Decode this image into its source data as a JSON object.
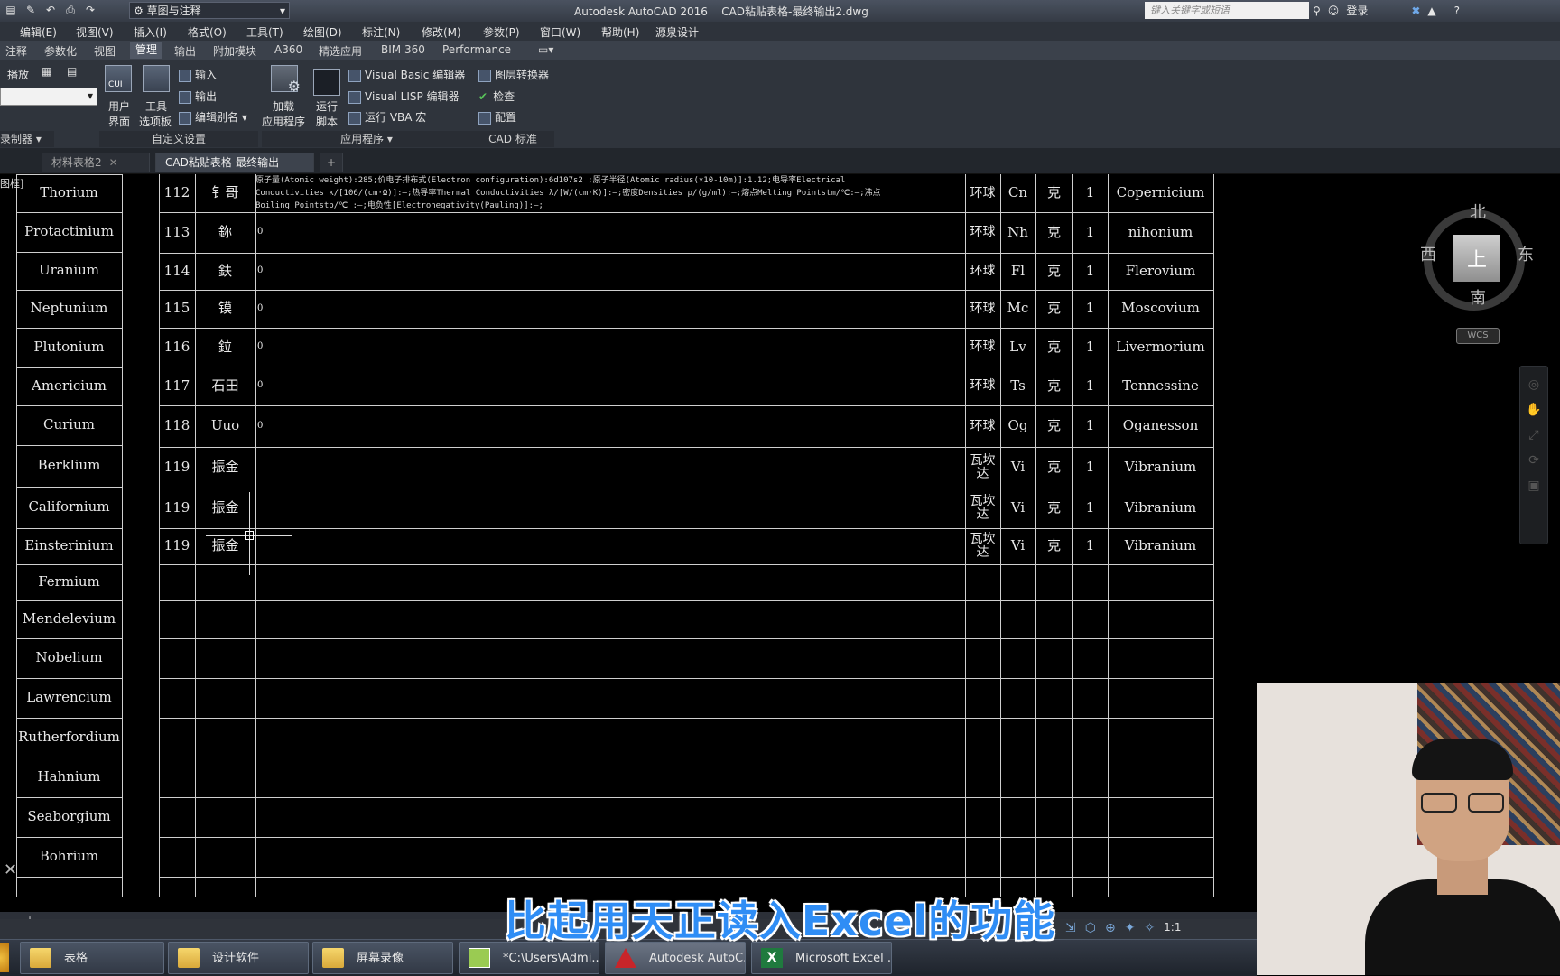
{
  "titlebar": {
    "workspace": "草图与注释",
    "app_name": "Autodesk AutoCAD 2016",
    "file_name": "CAD粘贴表格-最终输出2.dwg",
    "search_placeholder": "键入关键字或短语",
    "login": "登录"
  },
  "menubar": [
    "编辑(E)",
    "视图(V)",
    "插入(I)",
    "格式(O)",
    "工具(T)",
    "绘图(D)",
    "标注(N)",
    "修改(M)",
    "参数(P)",
    "窗口(W)",
    "帮助(H)",
    "源泉设计"
  ],
  "ribbon_tabs": [
    "注释",
    "参数化",
    "视图",
    "管理",
    "输出",
    "附加模块",
    "A360",
    "精选应用",
    "BIM 360",
    "Performance"
  ],
  "active_tab": "管理",
  "ribbon": {
    "play": "播放",
    "recorder_panel": "录制器",
    "cui_top": "用户",
    "cui_bottom": "界面",
    "tool_top": "工具",
    "tool_bottom": "选项板",
    "import": "输入",
    "export": "输出",
    "edit_aliases": "编辑别名",
    "customize_panel": "自定义设置",
    "load_top": "加载",
    "load_bottom": "应用程序",
    "run_top": "运行",
    "run_bottom": "脚本",
    "vba_editor": "Visual Basic 编辑器",
    "lisp_editor": "Visual LISP 编辑器",
    "run_vba": "运行 VBA 宏",
    "apps_panel": "应用程序",
    "layer_translator": "图层转换器",
    "check": "检查",
    "configure": "配置",
    "cad_std_panel": "CAD 标准"
  },
  "file_tabs": [
    {
      "label": "材料表格2",
      "active": false
    },
    {
      "label": "CAD粘贴表格-最终输出2*",
      "active": true
    }
  ],
  "left_names": {
    "header_fragment": "图框]",
    "items": [
      "Thorium",
      "Protactinium",
      "Uranium",
      "Neptunium",
      "Plutonium",
      "Americium",
      "Curium",
      "Berklium",
      "Californium",
      "Einsterinium",
      "Fermium",
      "Mendelevium",
      "Nobelium",
      "Lawrencium",
      "Rutherfordium",
      "Hahnium",
      "Seaborgium",
      "Bohrium"
    ]
  },
  "long_text": [
    "原子量(Atomic weight):285;价电子排布式(Electron configuration):6d107s2 ;原子半径(Atomic radius(×10-10m)]:1.12;电导率Electrical",
    "Conductivities κ/[106/(cm·Ω)]:—;热导率Thermal Conductivities λ/[W/(cm·K)]:—;密度Densities ρ/(g/ml):—;熔点Melting Pointstm/℃:—;沸点",
    "Boiling Pointstb/℃ :—;电负性[Electronegativity(Pauling)]:—;"
  ],
  "rows": [
    {
      "num": "112",
      "cn": "钅哥",
      "note": "",
      "shape": "环球",
      "sym": "Cn",
      "unit": "克",
      "qty": "1",
      "name": "Copernicium"
    },
    {
      "num": "113",
      "cn": "鉨",
      "note": "0",
      "shape": "环球",
      "sym": "Nh",
      "unit": "克",
      "qty": "1",
      "name": "nihonium"
    },
    {
      "num": "114",
      "cn": "鈇",
      "note": "0",
      "shape": "环球",
      "sym": "Fl",
      "unit": "克",
      "qty": "1",
      "name": "Flerovium"
    },
    {
      "num": "115",
      "cn": "镆",
      "note": "0",
      "shape": "环球",
      "sym": "Mc",
      "unit": "克",
      "qty": "1",
      "name": "Moscovium"
    },
    {
      "num": "116",
      "cn": "鉝",
      "note": "0",
      "shape": "环球",
      "sym": "Lv",
      "unit": "克",
      "qty": "1",
      "name": "Livermorium"
    },
    {
      "num": "117",
      "cn": "石田",
      "note": "0",
      "shape": "环球",
      "sym": "Ts",
      "unit": "克",
      "qty": "1",
      "name": "Tennessine"
    },
    {
      "num": "118",
      "cn": "Uuo",
      "note": "0",
      "shape": "环球",
      "sym": "Og",
      "unit": "克",
      "qty": "1",
      "name": "Oganesson"
    },
    {
      "num": "119",
      "cn": "振金",
      "note": "",
      "shape": "瓦坎达",
      "sym": "Vi",
      "unit": "克",
      "qty": "1",
      "name": "Vibranium"
    },
    {
      "num": "119",
      "cn": "振金",
      "note": "",
      "shape": "瓦坎达",
      "sym": "Vi",
      "unit": "克",
      "qty": "1",
      "name": "Vibranium"
    },
    {
      "num": "119",
      "cn": "振金",
      "note": "",
      "shape": "瓦坎达",
      "sym": "Vi",
      "unit": "克",
      "qty": "1",
      "name": "Vibranium"
    }
  ],
  "viewcube": {
    "north": "北",
    "south": "南",
    "east": "东",
    "west": "西",
    "face": "上",
    "wcs": "WCS"
  },
  "subtitle": "比起用天正读入Excel的功能",
  "status_scale": "1:1",
  "taskbar": [
    {
      "label": "表格",
      "icon": "folder-icon"
    },
    {
      "label": "设计软件",
      "icon": "folder-icon"
    },
    {
      "label": "屏幕录像",
      "icon": "folder-icon"
    },
    {
      "label": "*C:\\Users\\Admi...",
      "icon": "notepad-icon"
    },
    {
      "label": "Autodesk AutoC...",
      "icon": "autocad-icon"
    },
    {
      "label": "Microsoft Excel ...",
      "icon": "excel-icon"
    }
  ]
}
